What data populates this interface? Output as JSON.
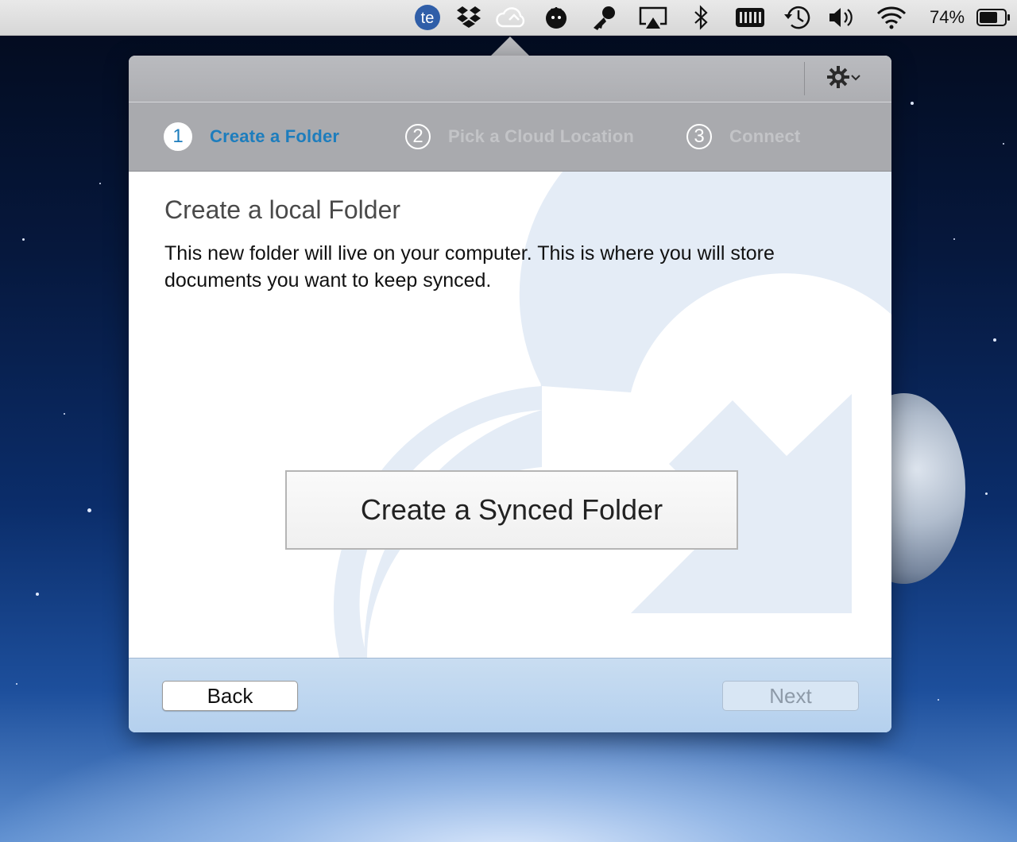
{
  "menubar": {
    "icons": [
      "te-icon",
      "dropbox-icon",
      "cloud-sync-icon",
      "cartoon-head-icon",
      "key-icon",
      "airplay-icon",
      "bluetooth-icon",
      "battery-bar-icon",
      "time-machine-icon",
      "volume-icon",
      "wifi-icon",
      "battery-icon"
    ],
    "te_label": "te",
    "battery_percent": "74%",
    "battery_level": 0.74
  },
  "toolbar": {
    "settings_icon": "gear-icon",
    "settings_dropdown_icon": "chevron-down-icon"
  },
  "steps": [
    {
      "number": "1",
      "label": "Create a Folder",
      "state": "active"
    },
    {
      "number": "2",
      "label": "Pick a Cloud Location",
      "state": "inactive"
    },
    {
      "number": "3",
      "label": "Connect",
      "state": "inactive"
    }
  ],
  "content": {
    "title": "Create a local Folder",
    "description": "This new folder will live on your computer. This is where you will store documents you want to keep synced.",
    "primary_button": "Create a Synced Folder"
  },
  "footer": {
    "back_label": "Back",
    "next_label": "Next",
    "next_enabled": false
  },
  "colors": {
    "accent": "#1d7dbd",
    "watermark": "#e4ecf6"
  }
}
